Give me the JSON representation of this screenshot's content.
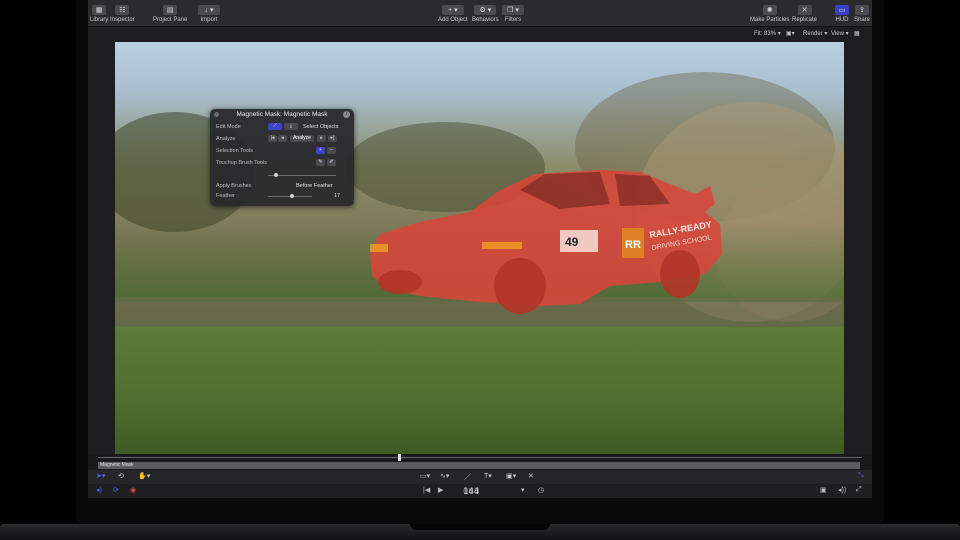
{
  "toolbar": {
    "library": "Library",
    "inspector": "Inspector",
    "project_pane": "Project Pane",
    "import": "Import",
    "add_object": "Add Object",
    "behaviors": "Behaviors",
    "filters": "Filters",
    "make_particles": "Make Particles",
    "replicate": "Replicate",
    "hud": "HUD",
    "share": "Share"
  },
  "view_bar": {
    "fit_label": "Fit:",
    "fit_value": "83%",
    "render": "Render",
    "view": "View"
  },
  "hud": {
    "title": "Magnetic Mask: Magnetic Mask",
    "edit_mode_label": "Edit Mode",
    "select_objects": "Select Objects",
    "analyze_label": "Analyze",
    "analyze_button": "Analyze",
    "selection_tools_label": "Selection Tools",
    "touchup_label": "Touchup Brush Tools",
    "apply_brushes_label": "Apply Brushes",
    "apply_brushes_value": "Before Feather",
    "feather_label": "Feather",
    "feather_value": "17",
    "info": "i"
  },
  "timeline": {
    "track_label": "Magnetic Mask",
    "timecode_prefix": "000",
    "timecode_frames": "144"
  },
  "colors": {
    "accent": "#3f43c9",
    "mask_overlay": "#d8463a"
  },
  "icons": [
    "library-icon",
    "inspector-icon",
    "project-pane-icon",
    "import-icon",
    "add-object-icon",
    "behaviors-icon",
    "filters-icon",
    "make-particles-icon",
    "replicate-icon",
    "hud-icon",
    "share-icon"
  ]
}
